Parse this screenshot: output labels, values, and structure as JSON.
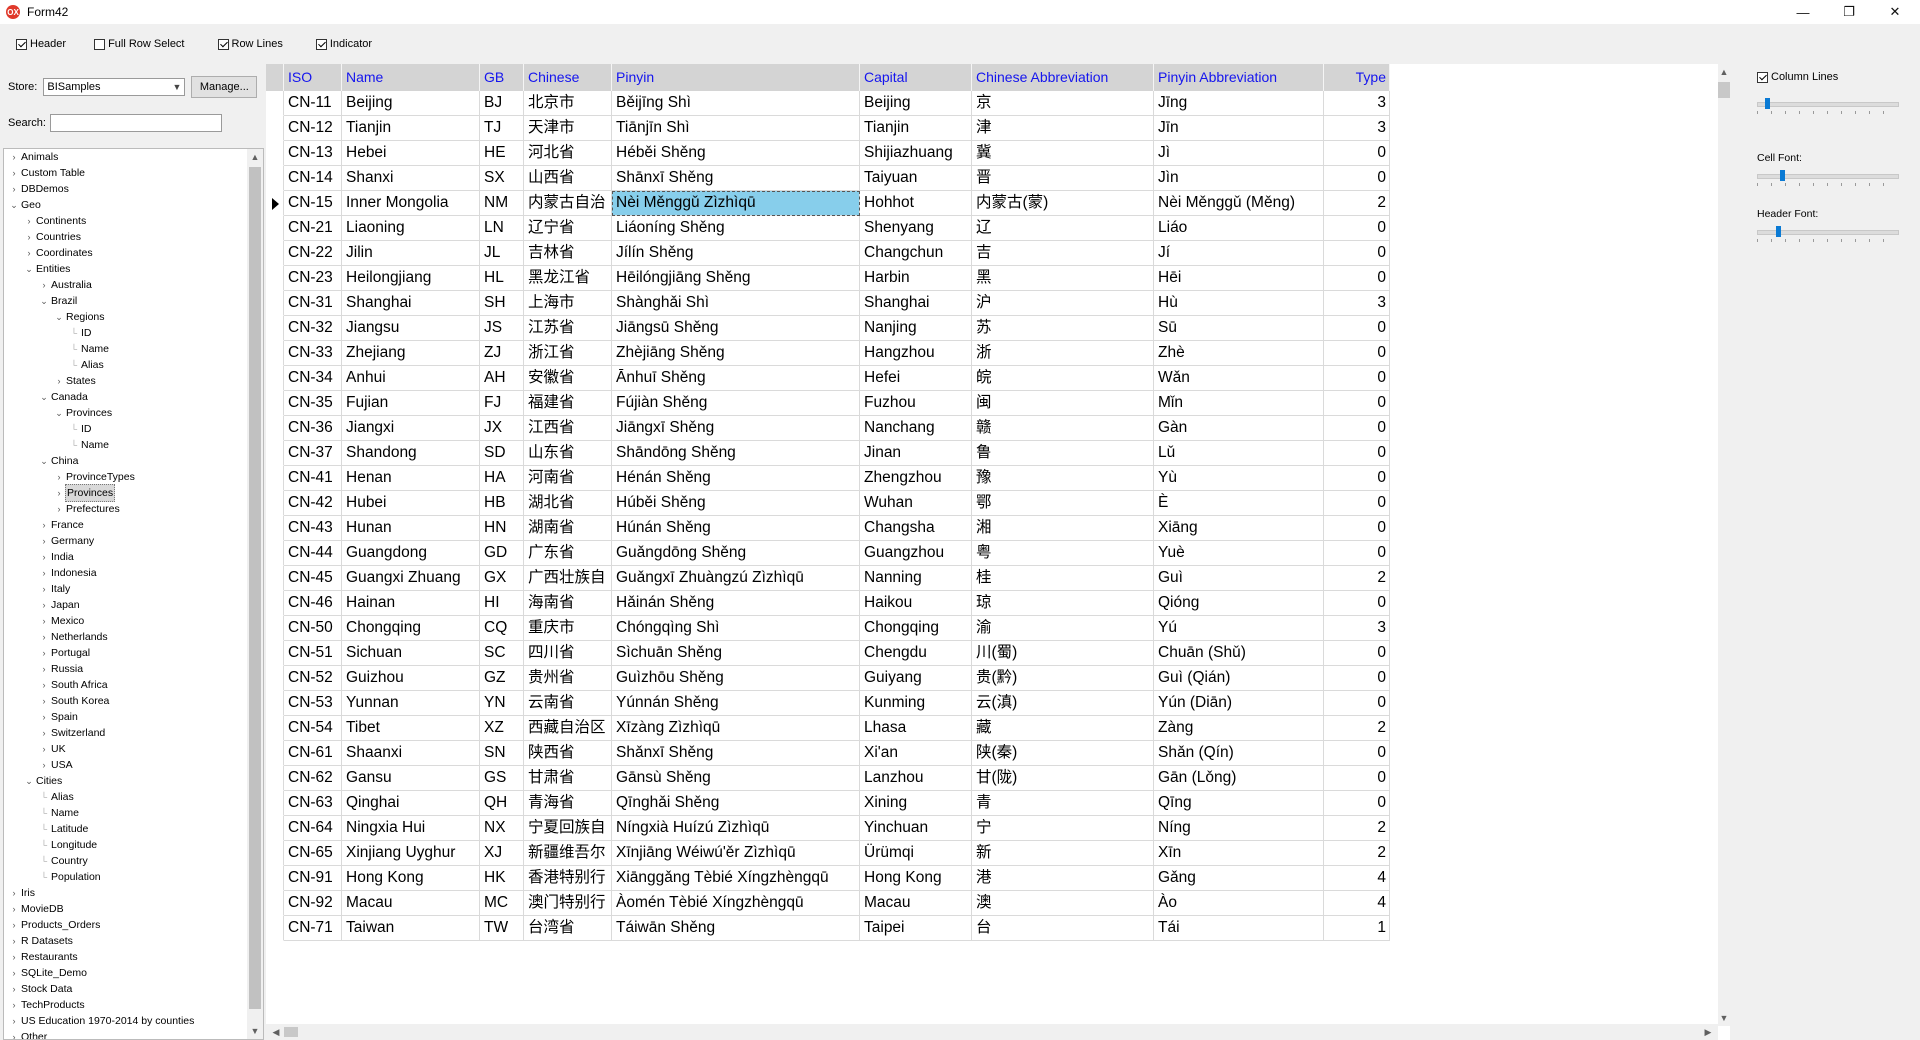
{
  "window": {
    "title": "Form42",
    "icon_text": "OX"
  },
  "options": [
    {
      "label": "Header",
      "checked": true
    },
    {
      "label": "Full Row Select",
      "checked": false
    },
    {
      "label": "Row Lines",
      "checked": true
    },
    {
      "label": "Indicator",
      "checked": true
    }
  ],
  "store": {
    "label": "Store:",
    "value": "BISamples",
    "manage_label": "Manage..."
  },
  "search": {
    "label": "Search:",
    "value": ""
  },
  "tree": [
    {
      "label": "Animals",
      "level": 0,
      "state": "collapsed"
    },
    {
      "label": "Custom Table",
      "level": 0,
      "state": "collapsed"
    },
    {
      "label": "DBDemos",
      "level": 0,
      "state": "collapsed"
    },
    {
      "label": "Geo",
      "level": 0,
      "state": "expanded"
    },
    {
      "label": "Continents",
      "level": 1,
      "state": "collapsed"
    },
    {
      "label": "Countries",
      "level": 1,
      "state": "collapsed"
    },
    {
      "label": "Coordinates",
      "level": 1,
      "state": "collapsed"
    },
    {
      "label": "Entities",
      "level": 1,
      "state": "expanded"
    },
    {
      "label": "Australia",
      "level": 2,
      "state": "collapsed"
    },
    {
      "label": "Brazil",
      "level": 2,
      "state": "expanded"
    },
    {
      "label": "Regions",
      "level": 3,
      "state": "expanded"
    },
    {
      "label": "ID",
      "level": 4,
      "state": "leaf"
    },
    {
      "label": "Name",
      "level": 4,
      "state": "leaf"
    },
    {
      "label": "Alias",
      "level": 4,
      "state": "leaf"
    },
    {
      "label": "States",
      "level": 3,
      "state": "collapsed"
    },
    {
      "label": "Canada",
      "level": 2,
      "state": "expanded"
    },
    {
      "label": "Provinces",
      "level": 3,
      "state": "expanded"
    },
    {
      "label": "ID",
      "level": 4,
      "state": "leaf"
    },
    {
      "label": "Name",
      "level": 4,
      "state": "leaf"
    },
    {
      "label": "China",
      "level": 2,
      "state": "expanded"
    },
    {
      "label": "ProvinceTypes",
      "level": 3,
      "state": "collapsed"
    },
    {
      "label": "Provinces",
      "level": 3,
      "state": "collapsed",
      "selected": true
    },
    {
      "label": "Prefectures",
      "level": 3,
      "state": "collapsed"
    },
    {
      "label": "France",
      "level": 2,
      "state": "collapsed"
    },
    {
      "label": "Germany",
      "level": 2,
      "state": "collapsed"
    },
    {
      "label": "India",
      "level": 2,
      "state": "collapsed"
    },
    {
      "label": "Indonesia",
      "level": 2,
      "state": "collapsed"
    },
    {
      "label": "Italy",
      "level": 2,
      "state": "collapsed"
    },
    {
      "label": "Japan",
      "level": 2,
      "state": "collapsed"
    },
    {
      "label": "Mexico",
      "level": 2,
      "state": "collapsed"
    },
    {
      "label": "Netherlands",
      "level": 2,
      "state": "collapsed"
    },
    {
      "label": "Portugal",
      "level": 2,
      "state": "collapsed"
    },
    {
      "label": "Russia",
      "level": 2,
      "state": "collapsed"
    },
    {
      "label": "South Africa",
      "level": 2,
      "state": "collapsed"
    },
    {
      "label": "South Korea",
      "level": 2,
      "state": "collapsed"
    },
    {
      "label": "Spain",
      "level": 2,
      "state": "collapsed"
    },
    {
      "label": "Switzerland",
      "level": 2,
      "state": "collapsed"
    },
    {
      "label": "UK",
      "level": 2,
      "state": "collapsed"
    },
    {
      "label": "USA",
      "level": 2,
      "state": "collapsed"
    },
    {
      "label": "Cities",
      "level": 1,
      "state": "expanded"
    },
    {
      "label": "Alias",
      "level": 2,
      "state": "leaf"
    },
    {
      "label": "Name",
      "level": 2,
      "state": "leaf"
    },
    {
      "label": "Latitude",
      "level": 2,
      "state": "leaf"
    },
    {
      "label": "Longitude",
      "level": 2,
      "state": "leaf"
    },
    {
      "label": "Country",
      "level": 2,
      "state": "leaf"
    },
    {
      "label": "Population",
      "level": 2,
      "state": "leaf"
    },
    {
      "label": "Iris",
      "level": 0,
      "state": "collapsed"
    },
    {
      "label": "MovieDB",
      "level": 0,
      "state": "collapsed"
    },
    {
      "label": "Products_Orders",
      "level": 0,
      "state": "collapsed"
    },
    {
      "label": "R Datasets",
      "level": 0,
      "state": "collapsed"
    },
    {
      "label": "Restaurants",
      "level": 0,
      "state": "collapsed"
    },
    {
      "label": "SQLite_Demo",
      "level": 0,
      "state": "collapsed"
    },
    {
      "label": "Stock Data",
      "level": 0,
      "state": "collapsed"
    },
    {
      "label": "TechProducts",
      "level": 0,
      "state": "collapsed"
    },
    {
      "label": "US Education 1970-2014 by counties",
      "level": 0,
      "state": "collapsed"
    },
    {
      "label": "Other",
      "level": 0,
      "state": "collapsed"
    }
  ],
  "grid": {
    "columns": [
      "ISO",
      "Name",
      "GB",
      "Chinese",
      "Pinyin",
      "Capital",
      "Chinese Abbreviation",
      "Pinyin Abbreviation",
      "Type"
    ],
    "current_row": 4,
    "selected_column": 4,
    "rows": [
      [
        "CN-11",
        "Beijing",
        "BJ",
        "北京市",
        "Běijīng Shì",
        "Beijing",
        "京",
        "Jīng",
        "3"
      ],
      [
        "CN-12",
        "Tianjin",
        "TJ",
        "天津市",
        "Tiānjīn Shì",
        "Tianjin",
        "津",
        "Jīn",
        "3"
      ],
      [
        "CN-13",
        "Hebei",
        "HE",
        "河北省",
        "Héběi Shěng",
        "Shijiazhuang",
        "冀",
        "Jì",
        "0"
      ],
      [
        "CN-14",
        "Shanxi",
        "SX",
        "山西省",
        "Shānxī Shěng",
        "Taiyuan",
        "晋",
        "Jìn",
        "0"
      ],
      [
        "CN-15",
        "Inner Mongolia",
        "NM",
        "内蒙古自治",
        "Nèi Měnggǔ Zìzhìqū",
        "Hohhot",
        "内蒙古(蒙)",
        "Nèi Měnggǔ (Měng)",
        "2"
      ],
      [
        "CN-21",
        "Liaoning",
        "LN",
        "辽宁省",
        "Liáoníng Shěng",
        "Shenyang",
        "辽",
        "Liáo",
        "0"
      ],
      [
        "CN-22",
        "Jilin",
        "JL",
        "吉林省",
        "Jílín Shěng",
        "Changchun",
        "吉",
        "Jí",
        "0"
      ],
      [
        "CN-23",
        "Heilongjiang",
        "HL",
        "黑龙江省",
        "Hēilóngjiāng Shěng",
        "Harbin",
        "黑",
        "Hēi",
        "0"
      ],
      [
        "CN-31",
        "Shanghai",
        "SH",
        "上海市",
        "Shànghǎi Shì",
        "Shanghai",
        "沪",
        "Hù",
        "3"
      ],
      [
        "CN-32",
        "Jiangsu",
        "JS",
        "江苏省",
        "Jiāngsū Shěng",
        "Nanjing",
        "苏",
        "Sū",
        "0"
      ],
      [
        "CN-33",
        "Zhejiang",
        "ZJ",
        "浙江省",
        "Zhèjiāng Shěng",
        "Hangzhou",
        "浙",
        "Zhè",
        "0"
      ],
      [
        "CN-34",
        "Anhui",
        "AH",
        "安徽省",
        "Ānhuī Shěng",
        "Hefei",
        "皖",
        "Wǎn",
        "0"
      ],
      [
        "CN-35",
        "Fujian",
        "FJ",
        "福建省",
        "Fújiàn Shěng",
        "Fuzhou",
        "闽",
        "Mǐn",
        "0"
      ],
      [
        "CN-36",
        "Jiangxi",
        "JX",
        "江西省",
        "Jiāngxī Shěng",
        "Nanchang",
        "赣",
        "Gàn",
        "0"
      ],
      [
        "CN-37",
        "Shandong",
        "SD",
        "山东省",
        "Shāndōng Shěng",
        "Jinan",
        "鲁",
        "Lǔ",
        "0"
      ],
      [
        "CN-41",
        "Henan",
        "HA",
        "河南省",
        "Hénán Shěng",
        "Zhengzhou",
        "豫",
        "Yù",
        "0"
      ],
      [
        "CN-42",
        "Hubei",
        "HB",
        "湖北省",
        "Húběi Shěng",
        "Wuhan",
        "鄂",
        "È",
        "0"
      ],
      [
        "CN-43",
        "Hunan",
        "HN",
        "湖南省",
        "Húnán Shěng",
        "Changsha",
        "湘",
        "Xiāng",
        "0"
      ],
      [
        "CN-44",
        "Guangdong",
        "GD",
        "广东省",
        "Guǎngdōng Shěng",
        "Guangzhou",
        "粤",
        "Yuè",
        "0"
      ],
      [
        "CN-45",
        "Guangxi Zhuang",
        "GX",
        "广西壮族自",
        "Guǎngxī Zhuàngzú Zìzhìqū",
        "Nanning",
        "桂",
        "Guì",
        "2"
      ],
      [
        "CN-46",
        "Hainan",
        "HI",
        "海南省",
        "Hǎinán Shěng",
        "Haikou",
        "琼",
        "Qióng",
        "0"
      ],
      [
        "CN-50",
        "Chongqing",
        "CQ",
        "重庆市",
        "Chóngqìng Shì",
        "Chongqing",
        "渝",
        "Yú",
        "3"
      ],
      [
        "CN-51",
        "Sichuan",
        "SC",
        "四川省",
        "Sìchuān Shěng",
        "Chengdu",
        "川(蜀)",
        "Chuān (Shǔ)",
        "0"
      ],
      [
        "CN-52",
        "Guizhou",
        "GZ",
        "贵州省",
        "Guìzhōu Shěng",
        "Guiyang",
        "贵(黔)",
        "Guì (Qián)",
        "0"
      ],
      [
        "CN-53",
        "Yunnan",
        "YN",
        "云南省",
        "Yúnnán Shěng",
        "Kunming",
        "云(滇)",
        "Yún (Diān)",
        "0"
      ],
      [
        "CN-54",
        "Tibet",
        "XZ",
        "西藏自治区",
        "Xīzàng Zìzhìqū",
        "Lhasa",
        "藏",
        "Zàng",
        "2"
      ],
      [
        "CN-61",
        "Shaanxi",
        "SN",
        "陕西省",
        "Shǎnxī Shěng",
        "Xi'an",
        "陕(秦)",
        "Shǎn (Qín)",
        "0"
      ],
      [
        "CN-62",
        "Gansu",
        "GS",
        "甘肃省",
        "Gānsù Shěng",
        "Lanzhou",
        "甘(陇)",
        "Gān (Lǒng)",
        "0"
      ],
      [
        "CN-63",
        "Qinghai",
        "QH",
        "青海省",
        "Qīnghǎi Shěng",
        "Xining",
        "青",
        "Qīng",
        "0"
      ],
      [
        "CN-64",
        "Ningxia Hui",
        "NX",
        "宁夏回族自",
        "Níngxià Huízú Zìzhìqū",
        "Yinchuan",
        "宁",
        "Níng",
        "2"
      ],
      [
        "CN-65",
        "Xinjiang Uyghur",
        "XJ",
        "新疆维吾尔",
        "Xīnjiāng Wéiwú'ěr Zìzhìqū",
        "Ürümqi",
        "新",
        "Xīn",
        "2"
      ],
      [
        "CN-91",
        "Hong Kong",
        "HK",
        "香港特别行",
        "Xiānggǎng Tèbié Xíngzhèngqū",
        "Hong Kong",
        "港",
        "Gǎng",
        "4"
      ],
      [
        "CN-92",
        "Macau",
        "MC",
        "澳门特别行",
        "Àomén Tèbié Xíngzhèngqū",
        "Macau",
        "澳",
        "Ào",
        "4"
      ],
      [
        "CN-71",
        "Taiwan",
        "TW",
        "台湾省",
        "Táiwān Shěng",
        "Taipei",
        "台",
        "Tái",
        "1"
      ]
    ]
  },
  "right_panel": {
    "column_lines": {
      "label": "Column Lines",
      "checked": true
    },
    "sliders": [
      {
        "name": "column-lines-slider",
        "label": "",
        "value": 0.06
      },
      {
        "name": "cell-font-slider",
        "label": "Cell Font:",
        "value": 0.17
      },
      {
        "name": "header-font-slider",
        "label": "Header Font:",
        "value": 0.14
      }
    ]
  },
  "colors": {
    "header_text": "#1515ee",
    "selected_cell": "#87ceeb",
    "header_bg": "#d4d4d4"
  }
}
